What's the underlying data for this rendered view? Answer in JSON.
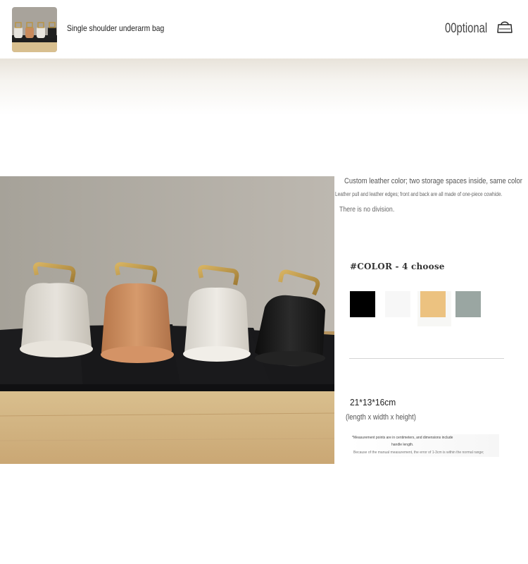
{
  "header": {
    "title": "Single shoulder underarm bag",
    "optional_label": "00ptional",
    "thumbnail_icon": "bag-thumbnail",
    "cart_icon": "shopping-bag-icon"
  },
  "description": {
    "line1": "Custom leather color; two storage spaces inside, same color",
    "line2": "Leather pull and leather edges; front and back are all made of one-piece cowhide.",
    "line3": "There is no division."
  },
  "color": {
    "title": "#COLOR - 4 choose",
    "swatches": [
      "#000000",
      "#f7f7f7",
      "#ecc280",
      "#9aa6a2"
    ]
  },
  "size": {
    "dimensions": "21*13*16cm",
    "unit_note": "(length x width x height)"
  },
  "notes": {
    "line1": "*Measurement points are in centimeters, and dimensions include",
    "line2": "handle length.",
    "line3": "Because of the manual measurement, the error of 1-3cm is within the normal range;"
  },
  "photo": {
    "subject": "four-bucket-bags-photo",
    "bag_colors": [
      "#d6d1c6",
      "#c98a5c",
      "#ddd9d0",
      "#1a1a1a"
    ]
  }
}
